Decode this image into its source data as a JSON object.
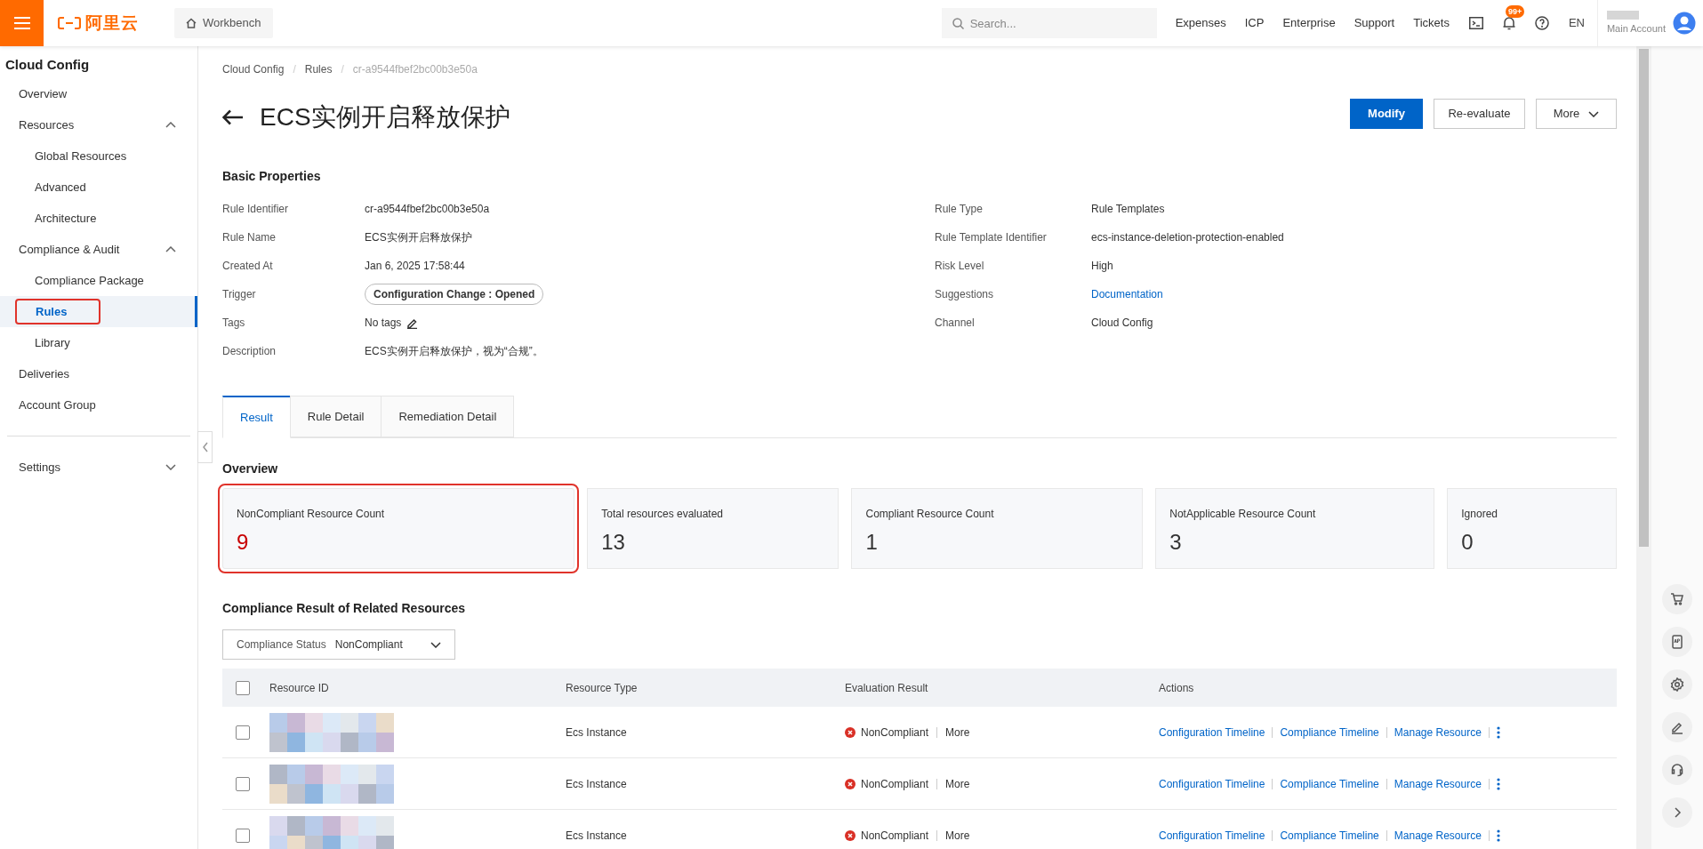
{
  "top_bar": {
    "logo_text": "阿里云",
    "workbench": "Workbench",
    "search_placeholder": "Search...",
    "links": [
      "Expenses",
      "ICP",
      "Enterprise",
      "Support",
      "Tickets"
    ],
    "notification_badge": "99+",
    "language": "EN",
    "account_label": "Main Account"
  },
  "sidebar": {
    "title": "Cloud Config",
    "items": [
      {
        "label": "Overview"
      },
      {
        "label": "Resources",
        "expanded": true,
        "children": [
          {
            "label": "Global Resources",
            "selected": false,
            "annotated": false
          },
          {
            "label": "Advanced",
            "selected": false,
            "annotated": false
          },
          {
            "label": "Architecture",
            "selected": false,
            "annotated": false
          }
        ]
      },
      {
        "label": "Compliance & Audit",
        "expanded": true,
        "children": [
          {
            "label": "Compliance Package",
            "selected": false,
            "annotated": false
          },
          {
            "label": "Rules",
            "selected": true,
            "annotated": true
          },
          {
            "label": "Library",
            "selected": false,
            "annotated": false
          }
        ]
      },
      {
        "label": "Deliveries"
      },
      {
        "label": "Account Group"
      }
    ],
    "footer_items": [
      {
        "label": "Settings",
        "expanded": false
      }
    ]
  },
  "breadcrumb": {
    "items": [
      "Cloud Config",
      "Rules",
      "cr-a9544fbef2bc00b3e50a"
    ],
    "separators": [
      "/",
      "/"
    ]
  },
  "page_title": "ECS实例开启释放保护",
  "header_buttons": [
    {
      "label": "Modify",
      "kind": "primary"
    },
    {
      "label": "Re-evaluate",
      "kind": "default"
    },
    {
      "label": "More",
      "kind": "dropdown"
    }
  ],
  "basic_properties": {
    "title": "Basic Properties",
    "left": [
      {
        "label": "Rule Identifier",
        "value": "cr-a9544fbef2bc00b3e50a",
        "kind": "text"
      },
      {
        "label": "Rule Name",
        "value": "ECS实例开启释放保护",
        "kind": "text"
      },
      {
        "label": "Created At",
        "value": "Jan 6, 2025 17:58:44",
        "kind": "text"
      },
      {
        "label": "Trigger",
        "value": "Configuration Change : Opened",
        "kind": "badge"
      },
      {
        "label": "Tags",
        "value": "No tags",
        "kind": "editable"
      },
      {
        "label": "Description",
        "value": "ECS实例开启释放保护，视为“合规”。",
        "kind": "text"
      }
    ],
    "right": [
      {
        "label": "Rule Type",
        "value": "Rule Templates",
        "kind": "text"
      },
      {
        "label": "Rule Template Identifier",
        "value": "ecs-instance-deletion-protection-enabled",
        "kind": "text"
      },
      {
        "label": "Risk Level",
        "value": "High",
        "kind": "text"
      },
      {
        "label": "Suggestions",
        "value": "Documentation",
        "kind": "link"
      },
      {
        "label": "Channel",
        "value": "Cloud Config",
        "kind": "text"
      }
    ]
  },
  "tabs": [
    {
      "label": "Result",
      "selected": true
    },
    {
      "label": "Rule Detail",
      "selected": false
    },
    {
      "label": "Remediation Detail",
      "selected": false
    }
  ],
  "overview": {
    "title": "Overview",
    "cards": [
      {
        "label": "NonCompliant Resource Count",
        "value": "9",
        "color": "#c80000",
        "annotated": true
      },
      {
        "label": "Total resources evaluated",
        "value": "13",
        "color": "#333333",
        "annotated": false
      },
      {
        "label": "Compliant Resource Count",
        "value": "1",
        "color": "#333333",
        "annotated": false
      },
      {
        "label": "NotApplicable Resource Count",
        "value": "3",
        "color": "#333333",
        "annotated": false
      },
      {
        "label": "Ignored",
        "value": "0",
        "color": "#333333",
        "annotated": false
      }
    ]
  },
  "results": {
    "title": "Compliance Result of Related Resources",
    "filter": {
      "label": "Compliance Status",
      "value": "NonCompliant"
    },
    "table": {
      "select_all_checked": false,
      "columns": [
        "Resource ID",
        "Resource Type",
        "Evaluation Result",
        "Actions"
      ],
      "rows": [
        {
          "checked": false,
          "resource_id": {
            "kind": "picture"
          },
          "resource_type": "Ecs Instance",
          "result": "NonCompliant",
          "result_more": "More",
          "actions": [
            "Configuration Timeline",
            "Compliance Timeline",
            "Manage Resource"
          ]
        },
        {
          "checked": false,
          "resource_id": {
            "kind": "picture"
          },
          "resource_type": "Ecs Instance",
          "result": "NonCompliant",
          "result_more": "More",
          "actions": [
            "Configuration Timeline",
            "Compliance Timeline",
            "Manage Resource"
          ]
        },
        {
          "checked": false,
          "resource_id": {
            "kind": "picture"
          },
          "resource_type": "Ecs Instance",
          "result": "NonCompliant",
          "result_more": "More",
          "actions": [
            "Configuration Timeline",
            "Compliance Timeline",
            "Manage Resource"
          ]
        }
      ]
    }
  }
}
